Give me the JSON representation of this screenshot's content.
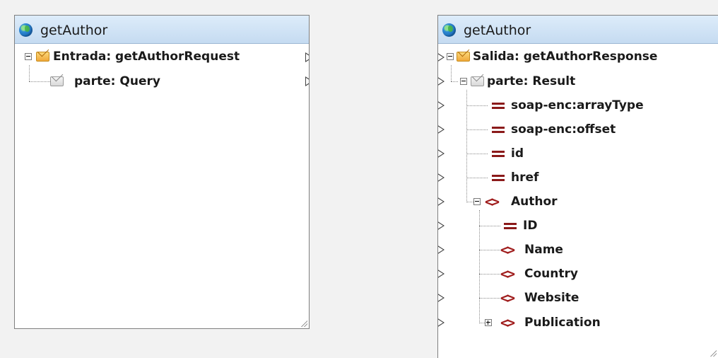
{
  "left_component": {
    "title": "getAuthor",
    "rows": [
      {
        "label": "Entrada: getAuthorRequest"
      },
      {
        "label": "parte: Query"
      }
    ]
  },
  "right_component": {
    "title": "getAuthor",
    "rows": [
      {
        "label": "Salida: getAuthorResponse"
      },
      {
        "label": "parte: Result"
      },
      {
        "label": "soap-enc:arrayType"
      },
      {
        "label": "soap-enc:offset"
      },
      {
        "label": "id"
      },
      {
        "label": "href"
      },
      {
        "label": "Author"
      },
      {
        "label": "ID"
      },
      {
        "label": "Name"
      },
      {
        "label": "Country"
      },
      {
        "label": "Website"
      },
      {
        "label": "Publication"
      }
    ]
  },
  "icons": {
    "globe": "globe-icon",
    "message": "envelope-icon",
    "attribute": "attribute-icon",
    "element": "element-icon",
    "connector": "connector-arrow-icon"
  },
  "colors": {
    "title_bar": "#c5dbf1",
    "attribute": "#8b1a1a",
    "element": "#a01e1e",
    "envelope": "#f0a83a"
  }
}
